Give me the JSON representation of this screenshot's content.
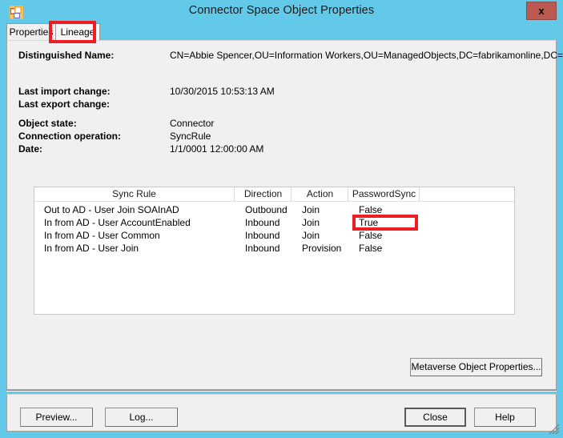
{
  "window": {
    "title": "Connector Space Object Properties",
    "icon": "app-window-icon",
    "close_label": "x",
    "frame_color": "#62c9e8",
    "close_button_color": "#bb5a52"
  },
  "tabs": [
    {
      "label": "Properties",
      "selected": false
    },
    {
      "label": "Lineage",
      "selected": true
    }
  ],
  "details": {
    "distinguished_name_label": "Distinguished Name:",
    "distinguished_name_value": "CN=Abbie Spencer,OU=Information Workers,OU=ManagedObjects,DC=fabrikamonline,DC=com",
    "last_import_change_label": "Last import change:",
    "last_import_change_value": "10/30/2015 10:53:13 AM",
    "last_export_change_label": "Last export change:",
    "last_export_change_value": "",
    "object_state_label": "Object state:",
    "object_state_value": "Connector",
    "connection_operation_label": "Connection operation:",
    "connection_operation_value": "SyncRule",
    "date_label": "Date:",
    "date_value": "1/1/0001 12:00:00 AM"
  },
  "lineage_table": {
    "columns": [
      "Sync Rule",
      "Direction",
      "Action",
      "PasswordSync",
      ""
    ],
    "rows": [
      {
        "rule": "Out to AD - User Join SOAInAD",
        "direction": "Outbound",
        "action": "Join",
        "password_sync": "False"
      },
      {
        "rule": "In from AD - User AccountEnabled",
        "direction": "Inbound",
        "action": "Join",
        "password_sync": "True"
      },
      {
        "rule": "In from AD - User Common",
        "direction": "Inbound",
        "action": "Join",
        "password_sync": "False"
      },
      {
        "rule": "In from AD - User Join",
        "direction": "Inbound",
        "action": "Provision",
        "password_sync": "False"
      }
    ]
  },
  "annotations": {
    "color": "#ee1d24",
    "highlighted_tab": "Lineage",
    "highlighted_cell": "True"
  },
  "buttons": {
    "metaverse": "Metaverse Object Properties...",
    "preview": "Preview...",
    "log": "Log...",
    "close": "Close",
    "help": "Help"
  }
}
